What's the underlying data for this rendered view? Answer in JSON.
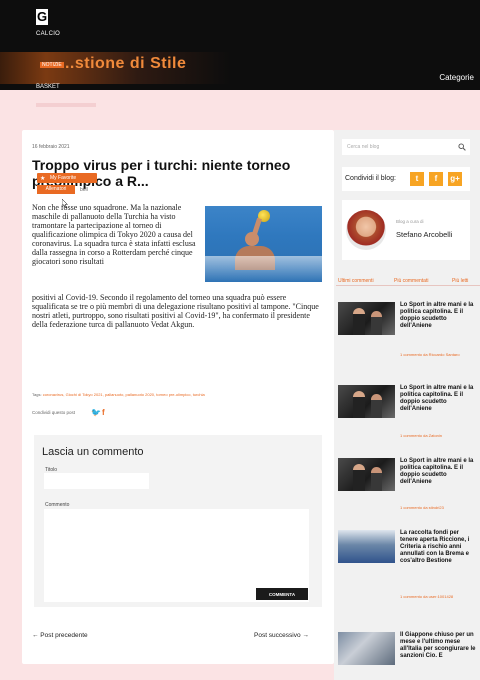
{
  "header": {
    "logo_letter": "G",
    "nav_calcio": "CALCIO",
    "banner_title": "...stione di Stile",
    "banner_tag": "NOTIZIE",
    "nav_basket": "BASKET",
    "categorie": "Categorie"
  },
  "article": {
    "date": "16 febbraio 2021",
    "title": "Troppo virus per i turchi: niente torneo preolimpico a R...",
    "favorite_label": "My Favorite",
    "author_badge": "Allenatori",
    "author_suffix": "bell",
    "body_intro": "Non che fosse uno squadrone. Ma la nazionale maschile di pallanuoto della Turchia ha visto tramontare la partecipazione al torneo di qualificazione olimpica di Tokyo 2020 a causa del coronavirus. La squadra turca è stata infatti esclusa dalla rassegna in corso a Rotterdam perché cinque giocatori sono risultati",
    "body_rest": "positivi al Covid-19. Secondo il regolamento del torneo una squadra può essere squalificata se tre o più membri di una delegazione risultano positivi al tampone. \"Cinque nostri atleti, purtroppo, sono risultati positivi al Covid-19\", ha confermato il presidente della federazione turca di pallanuoto Vedat Akgun.",
    "tags_label": "Tags:",
    "tags": "coronavirus, Giochi di Tokyo 2021, pallanuoto, pallanuoto 2020, torneo pre-olimpico, turchia",
    "share_label": "Condividi questo post"
  },
  "comment_form": {
    "title": "Lascia un commento",
    "titolo_label": "Titolo",
    "commento_label": "Commento",
    "submit_label": "COMMENTA"
  },
  "post_nav": {
    "prev": "← Post precedente",
    "next": "Post successivo →"
  },
  "sidebar": {
    "search_placeholder": "Cerca nel blog",
    "share_blog_label": "Condividi il blog:",
    "share_buttons": [
      "t",
      "f",
      "g+"
    ],
    "author_caption": "Blog a cura di",
    "author_name": "Stefano Arcobelli",
    "tabs": [
      "Ultimi commenti",
      "Più commentati",
      "Più letti"
    ],
    "posts": [
      {
        "title": "Lo Sport in altre mani e la politica capitolina. E il doppio scudetto dell'Aniene",
        "meta": "1 commento da Riccardo Santaro"
      },
      {
        "title": "Lo Sport in altre mani e la politica capitolina. E il doppio scudetto dell'Aniene",
        "meta": "1 commento da Zatonin"
      },
      {
        "title": "Lo Sport in altre mani e la politica capitolina. E il doppio scudetto dell'Aniene",
        "meta": "1 commento da stindri23"
      },
      {
        "title": "La raccolta fondi per tenere aperta Riccione, i Criteria a rischio anni annullati con la Brema e cos'altro Bestione",
        "meta": "1 commento da user:1001428"
      },
      {
        "title": "Il Giappone chiuso per un mese e l'ultimo mese all'Italia per scongiurare le sanzioni Cio. E",
        "meta": ""
      }
    ]
  },
  "colors": {
    "accent": "#e96a23",
    "background": "#fbe3e4",
    "header": "#0d0d0d"
  }
}
